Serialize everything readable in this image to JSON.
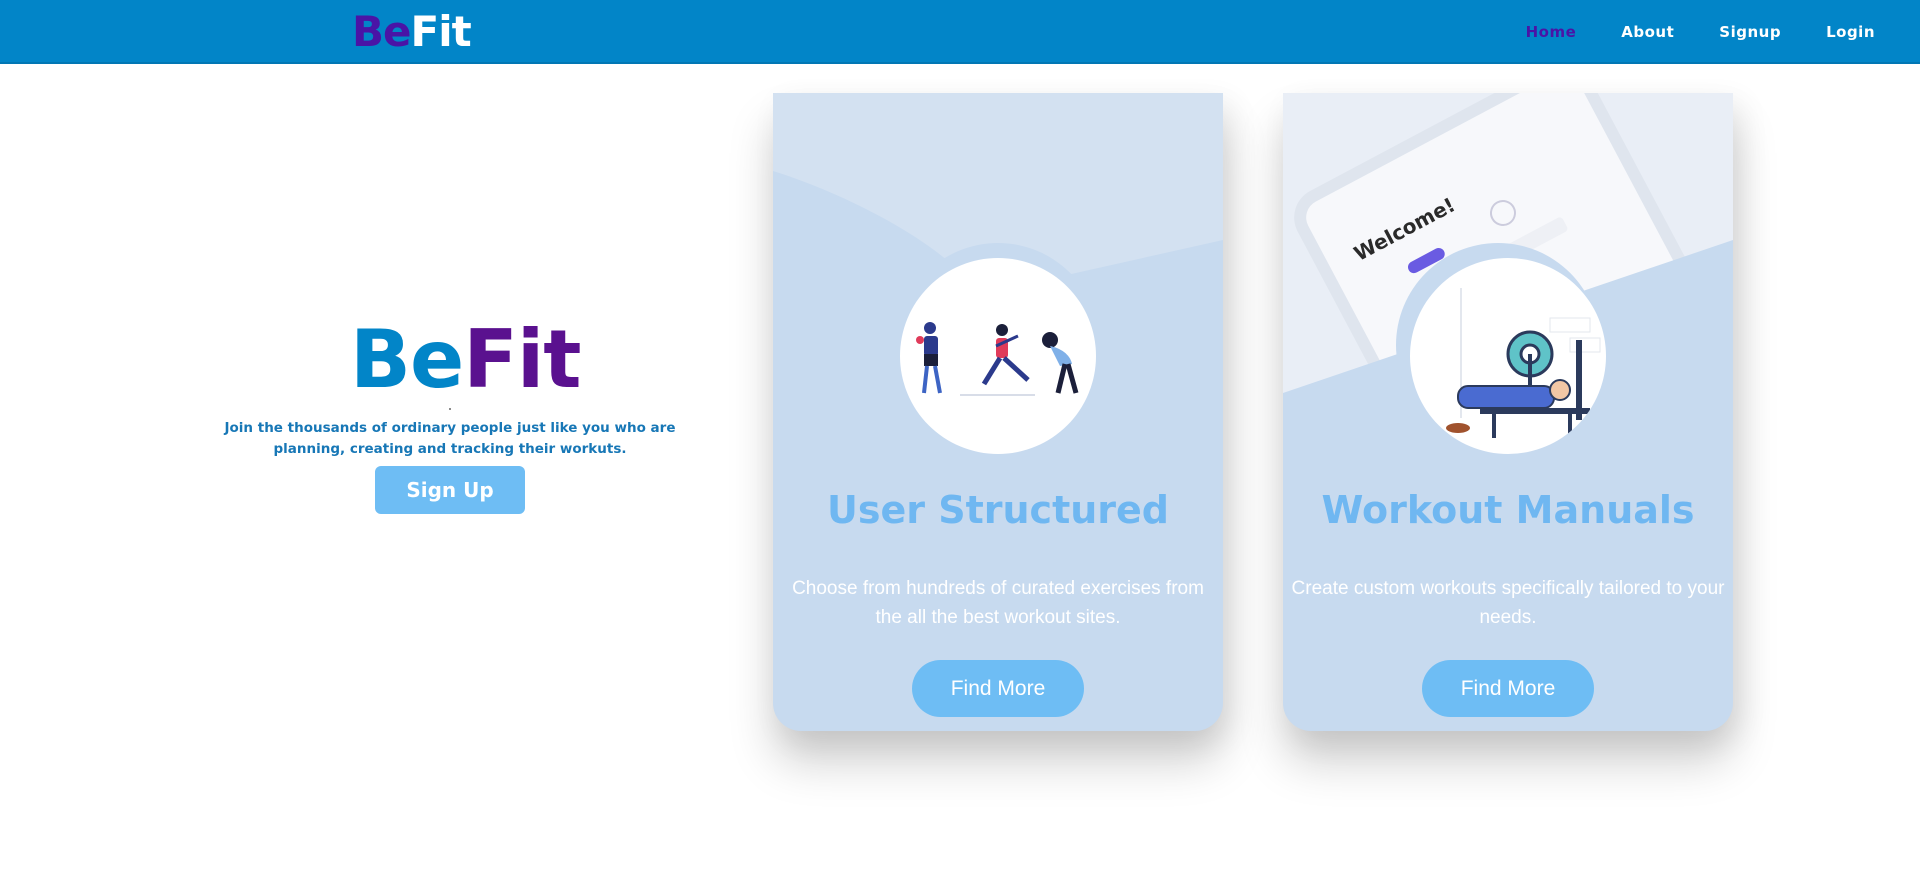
{
  "navbar": {
    "brand_be": "Be",
    "brand_fit": "Fit",
    "links": [
      {
        "label": "Home",
        "active": true
      },
      {
        "label": "About",
        "active": false
      },
      {
        "label": "Signup",
        "active": false
      },
      {
        "label": "Login",
        "active": false
      }
    ]
  },
  "hero": {
    "logo_be": "Be",
    "logo_fit": "Fit",
    "tagline": "Join the thousands of ordinary people just like you who are planning, creating and tracking their workuts.",
    "signup_label": "Sign Up"
  },
  "cards": [
    {
      "title": "User Structured",
      "text": "Choose from hundreds of curated exercises from the all the best workout sites.",
      "button": "Find More"
    },
    {
      "title": "Workout Manuals",
      "text": "Create custom workouts specifically tailored to your needs.",
      "button": "Find More",
      "phone_text": "Welcome!"
    }
  ],
  "colors": {
    "navbar": "#0285c8",
    "accent_purple": "#4a14a6",
    "button": "#6ebdf4",
    "card": "#c7daef"
  }
}
